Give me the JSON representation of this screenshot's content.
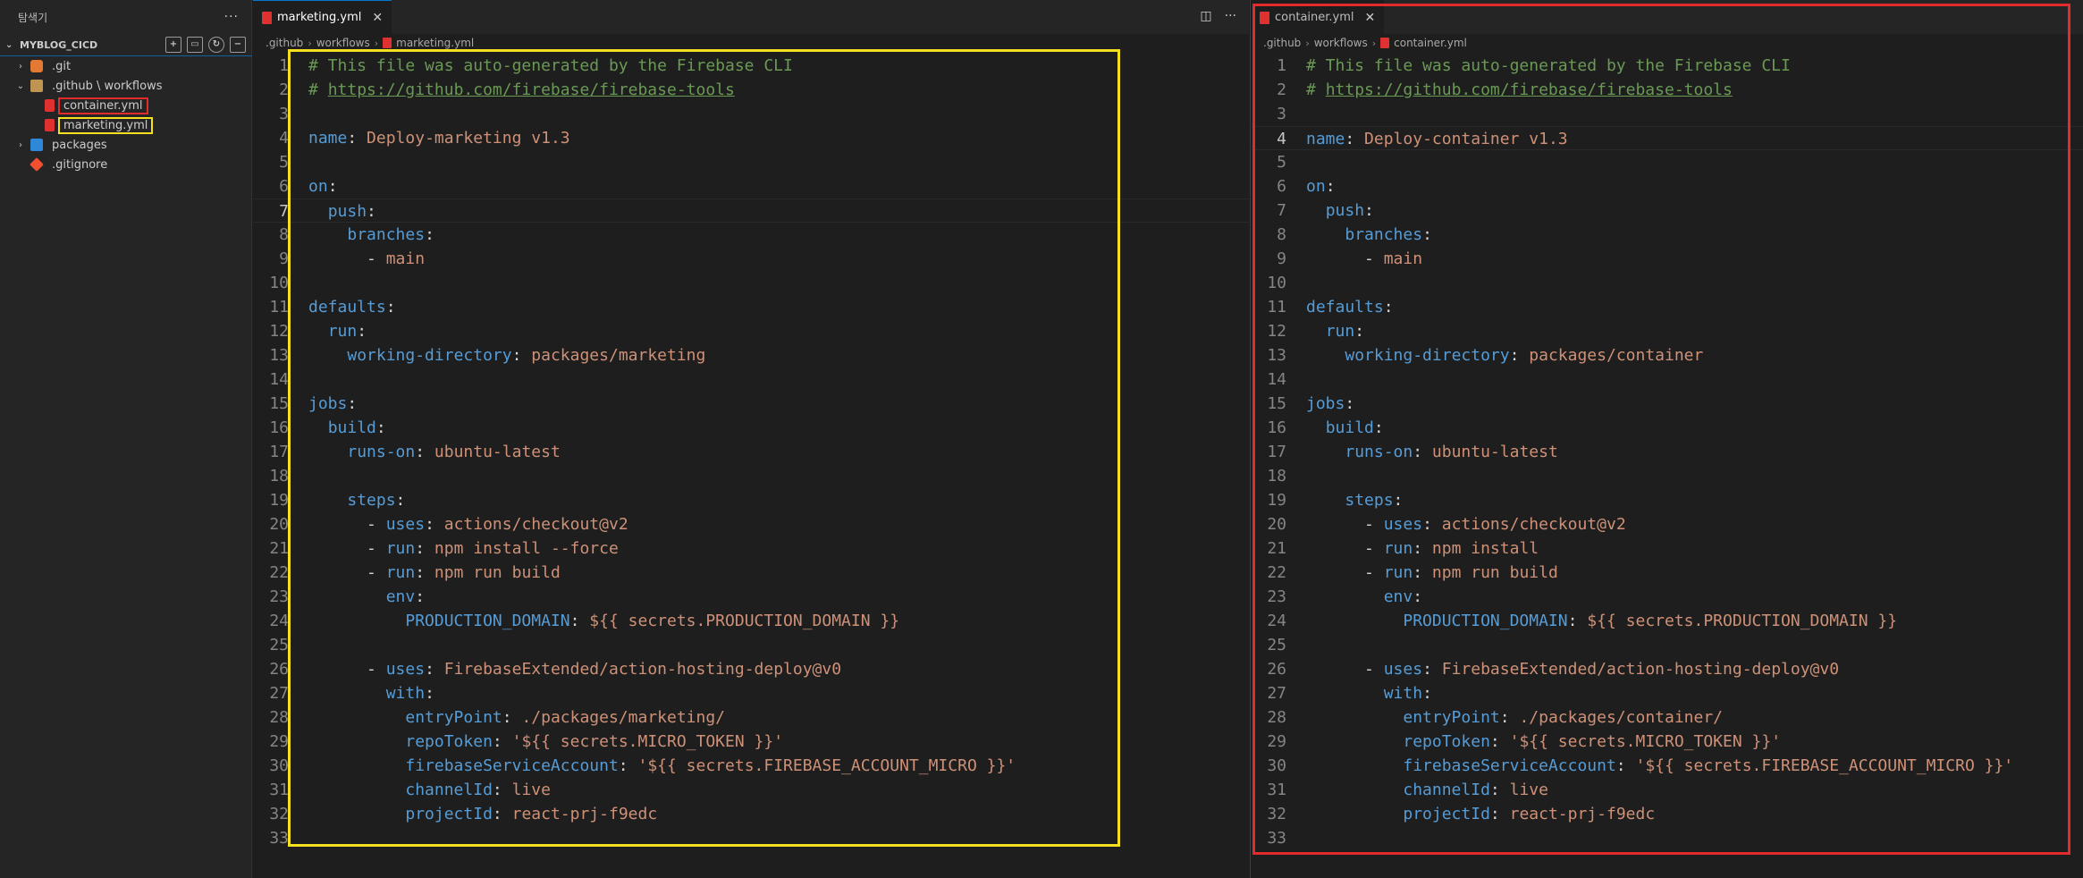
{
  "sidebar": {
    "title": "탐색기",
    "more": "···",
    "section": "MYBLOG_CICD",
    "tree": [
      {
        "label": ".git",
        "icon": "git-folder-icon",
        "indent": 0,
        "chevron": "›"
      },
      {
        "label": ".github \\ workflows",
        "icon": "folder-icon",
        "indent": 0,
        "chevron": "⌄"
      },
      {
        "label": "container.yml",
        "icon": "yaml-file-icon",
        "indent": 1,
        "chevron": ""
      },
      {
        "label": "marketing.yml",
        "icon": "yaml-file-icon",
        "indent": 1,
        "chevron": ""
      },
      {
        "label": "packages",
        "icon": "package-folder-icon",
        "indent": 0,
        "chevron": "›"
      },
      {
        "label": ".gitignore",
        "icon": "git-file-icon",
        "indent": 0,
        "chevron": ""
      }
    ]
  },
  "left_editor": {
    "tab": "marketing.yml",
    "breadcrumb": [
      ".github",
      "workflows",
      "marketing.yml"
    ],
    "active_line": 7
  },
  "right_editor": {
    "tab": "container.yml",
    "breadcrumb": [
      ".github",
      "workflows",
      "container.yml"
    ],
    "active_line": 4
  },
  "left_code": [
    [
      [
        "c",
        "# This file was auto-generated by the Firebase CLI"
      ]
    ],
    [
      [
        "c",
        "# "
      ],
      [
        "u",
        "https://github.com/firebase/firebase-tools"
      ]
    ],
    [],
    [
      [
        "k",
        "name"
      ],
      [
        "p",
        ": "
      ],
      [
        "v",
        "Deploy-marketing v1.3"
      ]
    ],
    [],
    [
      [
        "k",
        "on"
      ],
      [
        "p",
        ":"
      ]
    ],
    [
      [
        "p",
        "  "
      ],
      [
        "k",
        "push"
      ],
      [
        "p",
        ":"
      ]
    ],
    [
      [
        "p",
        "    "
      ],
      [
        "k",
        "branches"
      ],
      [
        "p",
        ":"
      ]
    ],
    [
      [
        "p",
        "      - "
      ],
      [
        "v",
        "main"
      ]
    ],
    [],
    [
      [
        "k",
        "defaults"
      ],
      [
        "p",
        ":"
      ]
    ],
    [
      [
        "p",
        "  "
      ],
      [
        "k",
        "run"
      ],
      [
        "p",
        ":"
      ]
    ],
    [
      [
        "p",
        "    "
      ],
      [
        "k",
        "working-directory"
      ],
      [
        "p",
        ": "
      ],
      [
        "v",
        "packages/marketing"
      ]
    ],
    [],
    [
      [
        "k",
        "jobs"
      ],
      [
        "p",
        ":"
      ]
    ],
    [
      [
        "p",
        "  "
      ],
      [
        "k",
        "build"
      ],
      [
        "p",
        ":"
      ]
    ],
    [
      [
        "p",
        "    "
      ],
      [
        "k",
        "runs-on"
      ],
      [
        "p",
        ": "
      ],
      [
        "v",
        "ubuntu-latest"
      ]
    ],
    [],
    [
      [
        "p",
        "    "
      ],
      [
        "k",
        "steps"
      ],
      [
        "p",
        ":"
      ]
    ],
    [
      [
        "p",
        "      - "
      ],
      [
        "k",
        "uses"
      ],
      [
        "p",
        ": "
      ],
      [
        "v",
        "actions/checkout@v2"
      ]
    ],
    [
      [
        "p",
        "      - "
      ],
      [
        "k",
        "run"
      ],
      [
        "p",
        ": "
      ],
      [
        "v",
        "npm install --force"
      ]
    ],
    [
      [
        "p",
        "      - "
      ],
      [
        "k",
        "run"
      ],
      [
        "p",
        ": "
      ],
      [
        "v",
        "npm run build"
      ]
    ],
    [
      [
        "p",
        "        "
      ],
      [
        "k",
        "env"
      ],
      [
        "p",
        ":"
      ]
    ],
    [
      [
        "p",
        "          "
      ],
      [
        "k",
        "PRODUCTION_DOMAIN"
      ],
      [
        "p",
        ": "
      ],
      [
        "v",
        "${{ secrets.PRODUCTION_DOMAIN }}"
      ]
    ],
    [],
    [
      [
        "p",
        "      - "
      ],
      [
        "k",
        "uses"
      ],
      [
        "p",
        ": "
      ],
      [
        "v",
        "FirebaseExtended/action-hosting-deploy@v0"
      ]
    ],
    [
      [
        "p",
        "        "
      ],
      [
        "k",
        "with"
      ],
      [
        "p",
        ":"
      ]
    ],
    [
      [
        "p",
        "          "
      ],
      [
        "k",
        "entryPoint"
      ],
      [
        "p",
        ": "
      ],
      [
        "v",
        "./packages/marketing/"
      ]
    ],
    [
      [
        "p",
        "          "
      ],
      [
        "k",
        "repoToken"
      ],
      [
        "p",
        ": "
      ],
      [
        "v",
        "'${{ secrets.MICRO_TOKEN }}'"
      ]
    ],
    [
      [
        "p",
        "          "
      ],
      [
        "k",
        "firebaseServiceAccount"
      ],
      [
        "p",
        ": "
      ],
      [
        "v",
        "'${{ secrets.FIREBASE_ACCOUNT_MICRO }}'"
      ]
    ],
    [
      [
        "p",
        "          "
      ],
      [
        "k",
        "channelId"
      ],
      [
        "p",
        ": "
      ],
      [
        "v",
        "live"
      ]
    ],
    [
      [
        "p",
        "          "
      ],
      [
        "k",
        "projectId"
      ],
      [
        "p",
        ": "
      ],
      [
        "v",
        "react-prj-f9edc"
      ]
    ],
    []
  ],
  "right_code": [
    [
      [
        "c",
        "# This file was auto-generated by the Firebase CLI"
      ]
    ],
    [
      [
        "c",
        "# "
      ],
      [
        "u",
        "https://github.com/firebase/firebase-tools"
      ]
    ],
    [],
    [
      [
        "k",
        "name"
      ],
      [
        "p",
        ": "
      ],
      [
        "v",
        "Deploy-container v1.3"
      ]
    ],
    [],
    [
      [
        "k",
        "on"
      ],
      [
        "p",
        ":"
      ]
    ],
    [
      [
        "p",
        "  "
      ],
      [
        "k",
        "push"
      ],
      [
        "p",
        ":"
      ]
    ],
    [
      [
        "p",
        "    "
      ],
      [
        "k",
        "branches"
      ],
      [
        "p",
        ":"
      ]
    ],
    [
      [
        "p",
        "      - "
      ],
      [
        "v",
        "main"
      ]
    ],
    [],
    [
      [
        "k",
        "defaults"
      ],
      [
        "p",
        ":"
      ]
    ],
    [
      [
        "p",
        "  "
      ],
      [
        "k",
        "run"
      ],
      [
        "p",
        ":"
      ]
    ],
    [
      [
        "p",
        "    "
      ],
      [
        "k",
        "working-directory"
      ],
      [
        "p",
        ": "
      ],
      [
        "v",
        "packages/container"
      ]
    ],
    [],
    [
      [
        "k",
        "jobs"
      ],
      [
        "p",
        ":"
      ]
    ],
    [
      [
        "p",
        "  "
      ],
      [
        "k",
        "build"
      ],
      [
        "p",
        ":"
      ]
    ],
    [
      [
        "p",
        "    "
      ],
      [
        "k",
        "runs-on"
      ],
      [
        "p",
        ": "
      ],
      [
        "v",
        "ubuntu-latest"
      ]
    ],
    [],
    [
      [
        "p",
        "    "
      ],
      [
        "k",
        "steps"
      ],
      [
        "p",
        ":"
      ]
    ],
    [
      [
        "p",
        "      - "
      ],
      [
        "k",
        "uses"
      ],
      [
        "p",
        ": "
      ],
      [
        "v",
        "actions/checkout@v2"
      ]
    ],
    [
      [
        "p",
        "      - "
      ],
      [
        "k",
        "run"
      ],
      [
        "p",
        ": "
      ],
      [
        "v",
        "npm install"
      ]
    ],
    [
      [
        "p",
        "      - "
      ],
      [
        "k",
        "run"
      ],
      [
        "p",
        ": "
      ],
      [
        "v",
        "npm run build"
      ]
    ],
    [
      [
        "p",
        "        "
      ],
      [
        "k",
        "env"
      ],
      [
        "p",
        ":"
      ]
    ],
    [
      [
        "p",
        "          "
      ],
      [
        "k",
        "PRODUCTION_DOMAIN"
      ],
      [
        "p",
        ": "
      ],
      [
        "v",
        "${{ secrets.PRODUCTION_DOMAIN }}"
      ]
    ],
    [],
    [
      [
        "p",
        "      - "
      ],
      [
        "k",
        "uses"
      ],
      [
        "p",
        ": "
      ],
      [
        "v",
        "FirebaseExtended/action-hosting-deploy@v0"
      ]
    ],
    [
      [
        "p",
        "        "
      ],
      [
        "k",
        "with"
      ],
      [
        "p",
        ":"
      ]
    ],
    [
      [
        "p",
        "          "
      ],
      [
        "k",
        "entryPoint"
      ],
      [
        "p",
        ": "
      ],
      [
        "v",
        "./packages/container/"
      ]
    ],
    [
      [
        "p",
        "          "
      ],
      [
        "k",
        "repoToken"
      ],
      [
        "p",
        ": "
      ],
      [
        "v",
        "'${{ secrets.MICRO_TOKEN }}'"
      ]
    ],
    [
      [
        "p",
        "          "
      ],
      [
        "k",
        "firebaseServiceAccount"
      ],
      [
        "p",
        ": "
      ],
      [
        "v",
        "'${{ secrets.FIREBASE_ACCOUNT_MICRO }}'"
      ]
    ],
    [
      [
        "p",
        "          "
      ],
      [
        "k",
        "channelId"
      ],
      [
        "p",
        ": "
      ],
      [
        "v",
        "live"
      ]
    ],
    [
      [
        "p",
        "          "
      ],
      [
        "k",
        "projectId"
      ],
      [
        "p",
        ": "
      ],
      [
        "v",
        "react-prj-f9edc"
      ]
    ],
    []
  ],
  "colors": {
    "highlight_left": "#f5e020",
    "highlight_right": "#e32b2b"
  }
}
